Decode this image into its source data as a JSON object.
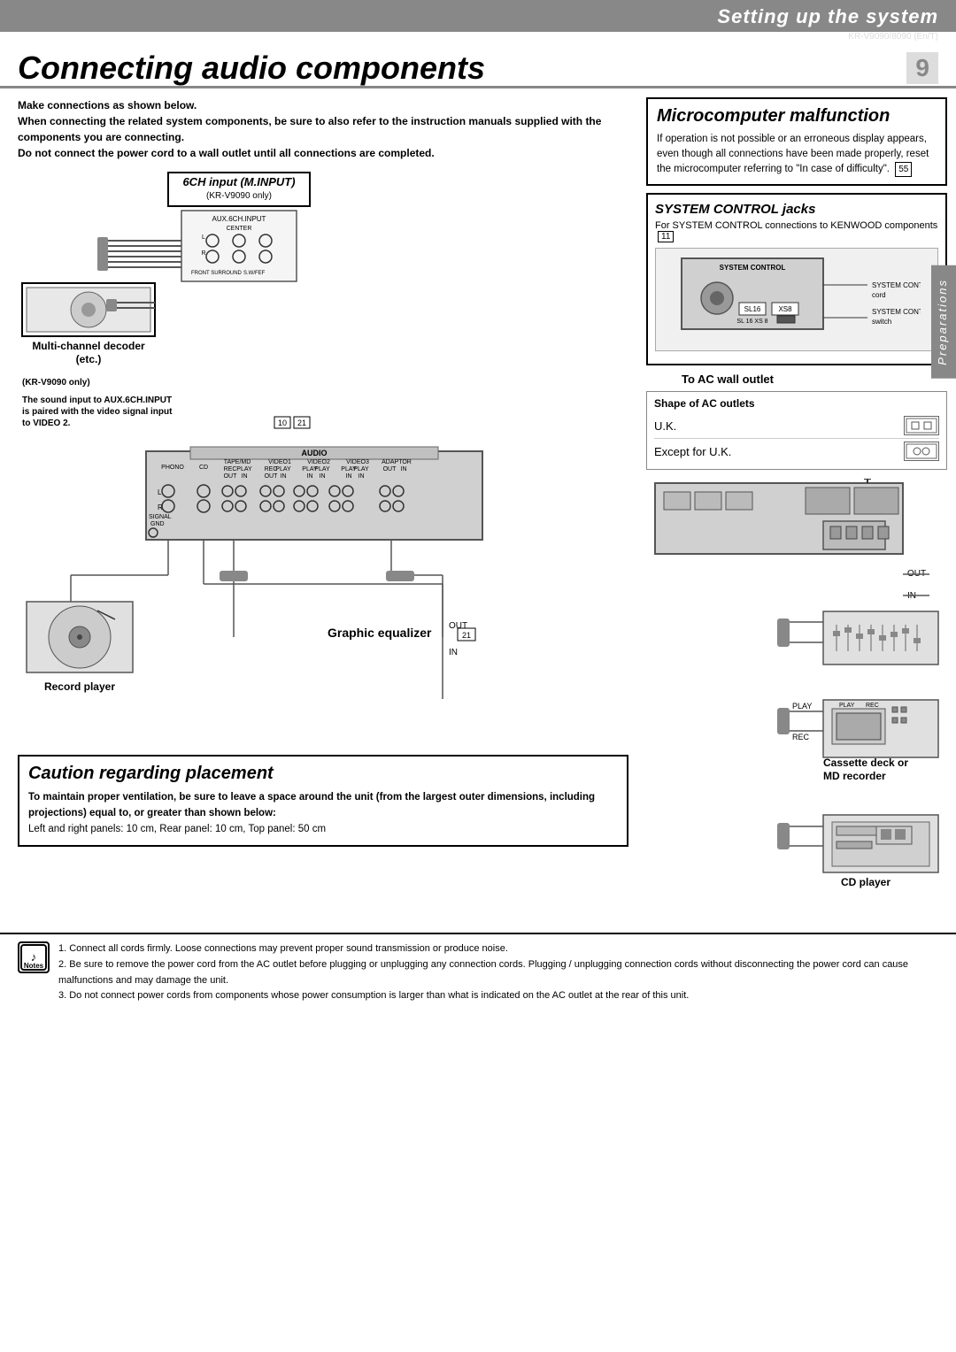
{
  "header": {
    "title": "Setting up the system",
    "model": "KR-V9090/8090 (En/T)"
  },
  "page": {
    "title": "Connecting audio components",
    "number": "9"
  },
  "side_tab": "Preparations",
  "intro": {
    "line1": "Make connections as shown below.",
    "line2": "When connecting the related system components, be sure to also refer to the instruction manuals supplied with the components you are connecting.",
    "line3": "Do not connect the power cord to a wall outlet until all connections are completed."
  },
  "microcomputer": {
    "title": "Microcomputer malfunction",
    "text": "If operation is not possible or an erroneous display appears, even though all connections have been made properly, reset the microcomputer referring to \"In case of difficulty\".",
    "ref": "55"
  },
  "input_6ch": {
    "title": "6CH input (M.INPUT)",
    "subtitle": "(KR-V9090 only)"
  },
  "system_control": {
    "title": "SYSTEM CONTROL  jacks",
    "text": "For SYSTEM CONTROL connections to KENWOOD components",
    "ref": "11",
    "cord_label": "SYSTEM CONTROL cord",
    "switch_label": "SYSTEM CONTROL switch"
  },
  "to_ac": {
    "label": "To AC wall outlet"
  },
  "shape_of_ac": {
    "title": "Shape of AC outlets",
    "uk_label": "U.K.",
    "except_uk_label": "Except for U.K."
  },
  "multi_channel": {
    "label": "Multi-channel decoder",
    "sublabel": "(etc.)"
  },
  "sound_note": {
    "text": "The sound input to AUX.6CH.INPUT is paired with the video signal input to VIDEO 2.",
    "refs": "10  21"
  },
  "record_player": {
    "label": "Record player"
  },
  "graphic_eq": {
    "label": "Graphic equalizer",
    "ref": "21"
  },
  "cassette_deck": {
    "label": "Cassette deck or",
    "sublabel": "MD recorder"
  },
  "cd_player": {
    "label": "CD player"
  },
  "caution": {
    "title": "Caution regarding placement",
    "bold_text": "To maintain proper ventilation, be sure to leave a space around the unit (from the largest outer dimensions, including projections) equal to, or greater than shown below:",
    "text": "Left and right panels: 10 cm, Rear panel: 10 cm, Top panel: 50 cm"
  },
  "notes": {
    "label": "Notes",
    "items": [
      "Connect all cords firmly. Loose connections may prevent proper sound transmission or produce noise.",
      "Be sure to remove the power cord from the AC outlet before plugging or unplugging any connection cords. Plugging / unplugging connection cords without disconnecting the power cord can cause malfunctions and may damage the unit.",
      "Do not connect power cords from components whose power consumption is larger than what is indicated on the AC outlet at the rear of this unit."
    ]
  }
}
